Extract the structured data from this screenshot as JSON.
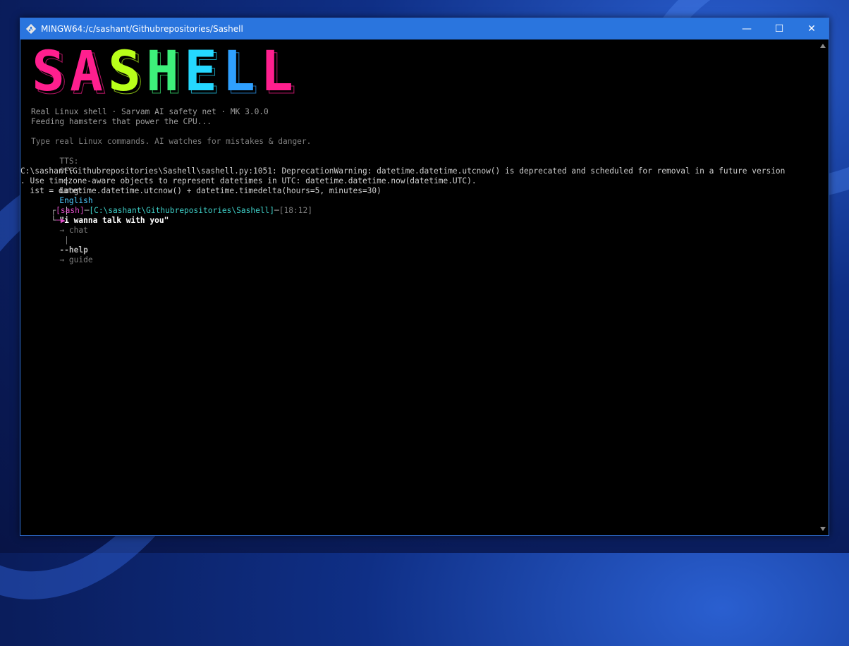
{
  "window": {
    "title": "MINGW64:/c/sashant/Githubrepositories/Sashell",
    "minimize_glyph": "—",
    "maximize_glyph": "☐",
    "close_glyph": "✕",
    "icon": "git-bash-icon"
  },
  "banner": {
    "text": "SASHELL",
    "colors": [
      "#ff1f8e",
      "#ff1f8e",
      "#b8ff1a",
      "#3df07a",
      "#25d8ff",
      "#2fa0ff",
      "#ff1f8e"
    ]
  },
  "intro": {
    "line1": "Real Linux shell · Sarvam AI safety net · MK 3.0.0",
    "line2": "Feeding hamsters that power the CPU...",
    "line3": "Type real Linux commands. AI watches for mistakes & danger."
  },
  "status": {
    "tts_label": "TTS:",
    "tts_value": "OFF",
    "sep1": "|",
    "lang_label": "Lang:",
    "lang_value": "English",
    "sep2": "|",
    "chat_phrase": "\"i wanna talk with you\"",
    "chat_hint": "→ chat",
    "sep3": "|",
    "help_flag": "--help",
    "help_hint": "→ guide"
  },
  "output": {
    "warning_line1": "C:\\sashant\\Githubrepositories\\Sashell\\sashell.py:1051: DeprecationWarning: datetime.datetime.utcnow() is deprecated and scheduled for removal in a future version",
    "warning_line2": ". Use timezone-aware objects to represent datetimes in UTC: datetime.datetime.now(datetime.UTC).",
    "warning_line3": "  ist = datetime.datetime.utcnow() + datetime.timedelta(hours=5, minutes=30)"
  },
  "prompt": {
    "corner_top": "┌",
    "user": "[sash]",
    "dash1": "─",
    "path": "[C:\\sashant\\Githubrepositories\\Sashell]",
    "dash2": "─",
    "time": "[18:12]",
    "corner_bottom": "└",
    "arrow": "─▶"
  },
  "colors": {
    "titlebar": "#2a75de",
    "terminal_bg": "#000000",
    "accent_cyan": "#4ec9ff",
    "prompt_magenta": "#e04cc8"
  }
}
